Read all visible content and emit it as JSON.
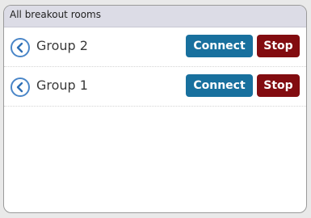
{
  "panel": {
    "title": "All breakout rooms"
  },
  "rooms": [
    {
      "name": "Group 2",
      "connect_label": "Connect",
      "stop_label": "Stop"
    },
    {
      "name": "Group 1",
      "connect_label": "Connect",
      "stop_label": "Stop"
    }
  ],
  "icons": {
    "room_icon": "chevron-left-circle-icon"
  },
  "colors": {
    "connect_button": "#18709e",
    "stop_button": "#820c10",
    "icon_accent": "#4a86c8",
    "header_background": "#dcdce6"
  }
}
